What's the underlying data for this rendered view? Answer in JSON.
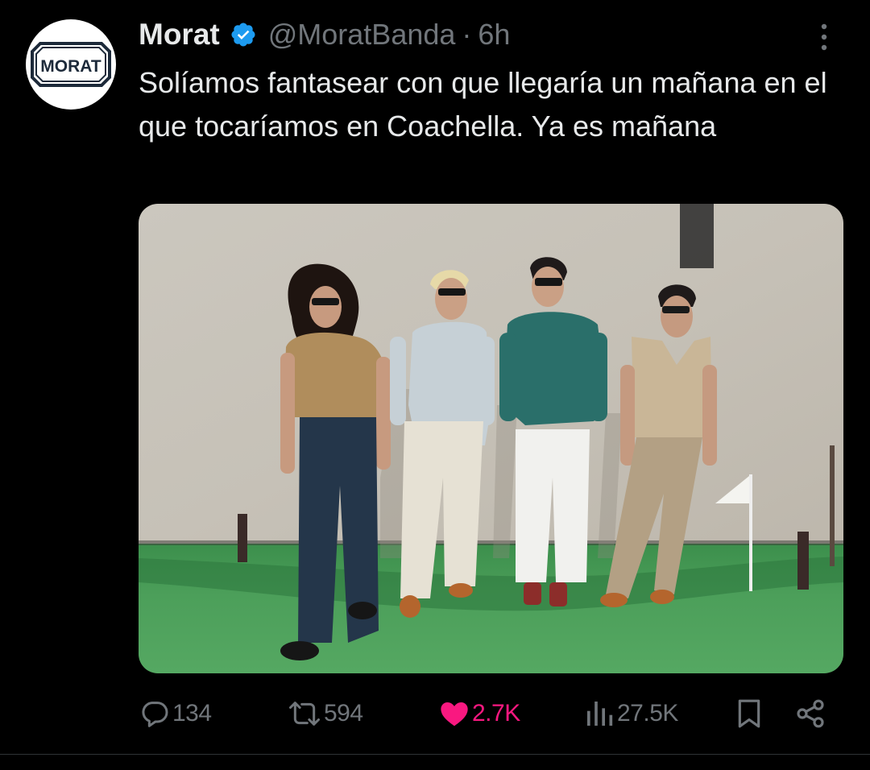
{
  "author": {
    "display_name": "Morat",
    "handle": "@MoratBanda",
    "separator": "·",
    "time": "6h",
    "avatar_text": "MORAT",
    "verified": true
  },
  "tweet": {
    "text": "Solíamos fantasear con que llegaría un mañana en el que tocaríamos en Coachella. Ya es mañana"
  },
  "actions": {
    "replies": "134",
    "reposts": "594",
    "likes": "2.7K",
    "views": "27.5K"
  },
  "colors": {
    "background": "#000000",
    "text_primary": "#e7e9ea",
    "text_secondary": "#71767b",
    "verified_blue": "#1d9bf0",
    "like_pink": "#f91880"
  },
  "icons": {
    "more": "more-icon",
    "verified": "verified-badge-icon",
    "reply": "reply-icon",
    "repost": "repost-icon",
    "like": "heart-icon",
    "views": "views-icon",
    "bookmark": "bookmark-icon",
    "share": "share-icon"
  }
}
